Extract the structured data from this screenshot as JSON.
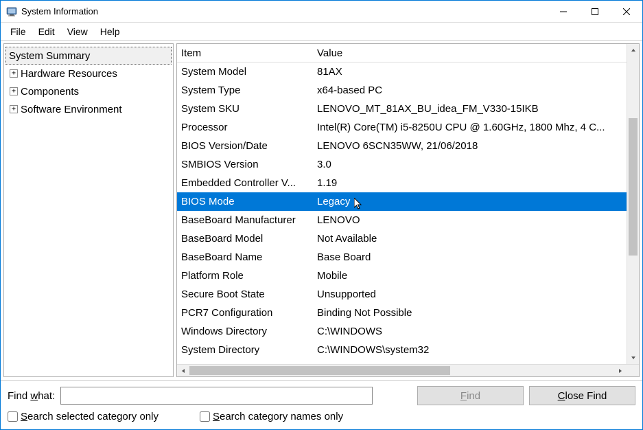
{
  "window": {
    "title": "System Information"
  },
  "menu": {
    "file": "File",
    "edit": "Edit",
    "view": "View",
    "help": "Help"
  },
  "tree": {
    "root": "System Summary",
    "children": [
      "Hardware Resources",
      "Components",
      "Software Environment"
    ]
  },
  "table": {
    "header_item": "Item",
    "header_value": "Value",
    "rows": [
      {
        "item": "System Model",
        "value": "81AX",
        "selected": false
      },
      {
        "item": "System Type",
        "value": "x64-based PC",
        "selected": false
      },
      {
        "item": "System SKU",
        "value": "LENOVO_MT_81AX_BU_idea_FM_V330-15IKB",
        "selected": false
      },
      {
        "item": "Processor",
        "value": "Intel(R) Core(TM) i5-8250U CPU @ 1.60GHz, 1800 Mhz, 4 C...",
        "selected": false
      },
      {
        "item": "BIOS Version/Date",
        "value": "LENOVO 6SCN35WW, 21/06/2018",
        "selected": false
      },
      {
        "item": "SMBIOS Version",
        "value": "3.0",
        "selected": false
      },
      {
        "item": "Embedded Controller V...",
        "value": "1.19",
        "selected": false
      },
      {
        "item": "BIOS Mode",
        "value": "Legacy",
        "selected": true
      },
      {
        "item": "BaseBoard Manufacturer",
        "value": "LENOVO",
        "selected": false
      },
      {
        "item": "BaseBoard Model",
        "value": "Not Available",
        "selected": false
      },
      {
        "item": "BaseBoard Name",
        "value": "Base Board",
        "selected": false
      },
      {
        "item": "Platform Role",
        "value": "Mobile",
        "selected": false
      },
      {
        "item": "Secure Boot State",
        "value": "Unsupported",
        "selected": false
      },
      {
        "item": "PCR7 Configuration",
        "value": "Binding Not Possible",
        "selected": false
      },
      {
        "item": "Windows Directory",
        "value": "C:\\WINDOWS",
        "selected": false
      },
      {
        "item": "System Directory",
        "value": "C:\\WINDOWS\\system32",
        "selected": false
      }
    ]
  },
  "find": {
    "label_prefix": "Find ",
    "label_u": "w",
    "label_suffix": "hat:",
    "input_value": "",
    "find_btn": "Find",
    "close_btn_prefix": "",
    "close_btn_u": "C",
    "close_btn_suffix": "lose Find",
    "cb1_u": "S",
    "cb1_rest": "earch selected category only",
    "cb2_u": "S",
    "cb2_rest": "earch category names only"
  }
}
